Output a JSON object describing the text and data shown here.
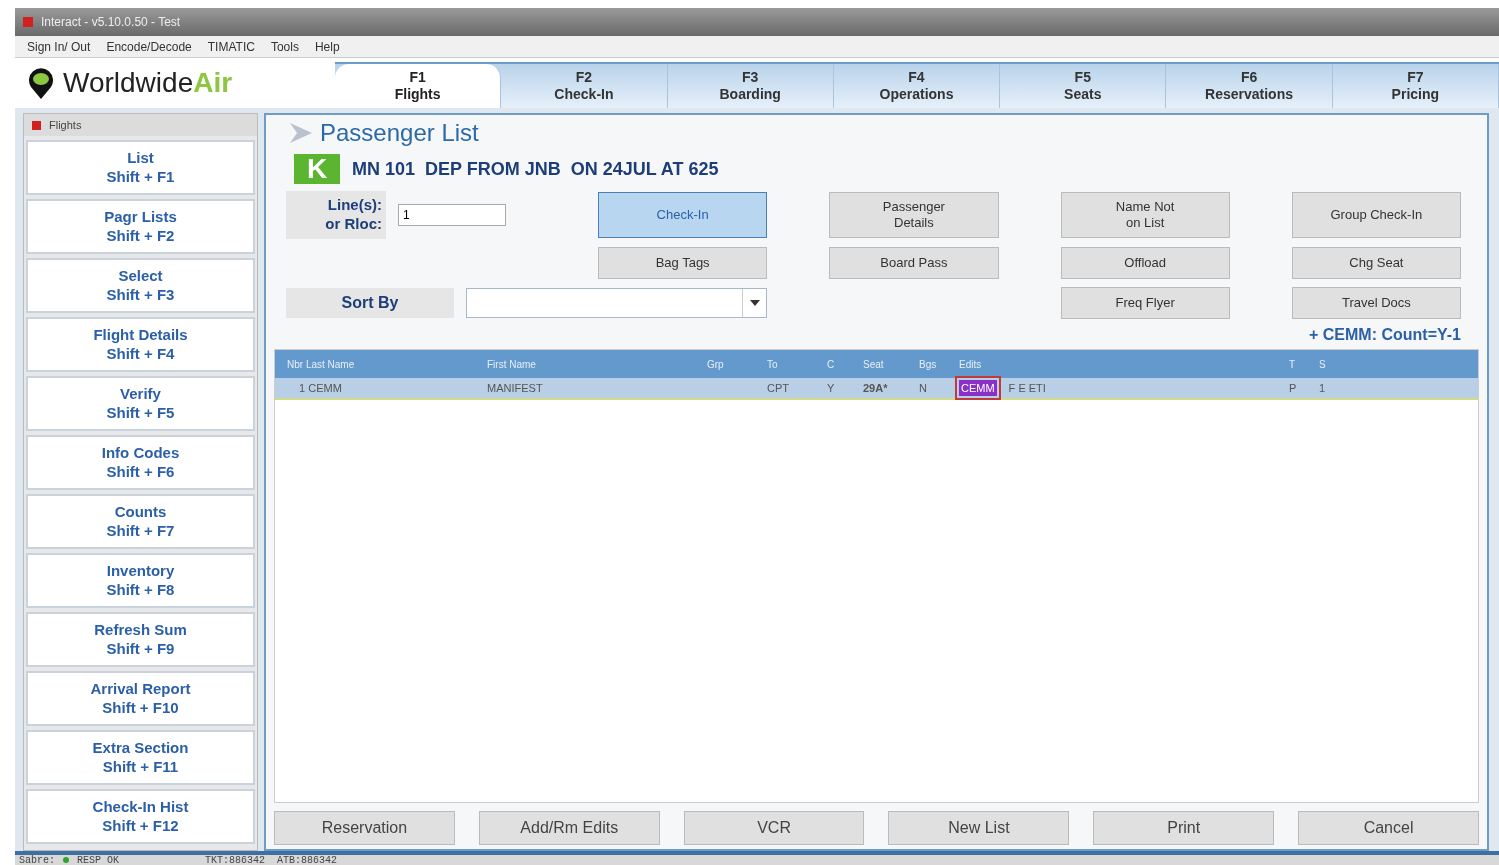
{
  "window": {
    "title": "Interact - v5.10.0.50 - Test"
  },
  "menu": [
    "Sign In/ Out",
    "Encode/Decode",
    "TIMATIC",
    "Tools",
    "Help"
  ],
  "logo": {
    "name": "Worldwide",
    "accent": "Air"
  },
  "tabs": [
    {
      "key": "F1",
      "label": "Flights",
      "selected": true
    },
    {
      "key": "F2",
      "label": "Check-In",
      "selected": false
    },
    {
      "key": "F3",
      "label": "Boarding",
      "selected": false
    },
    {
      "key": "F4",
      "label": "Operations",
      "selected": false
    },
    {
      "key": "F5",
      "label": "Seats",
      "selected": false
    },
    {
      "key": "F6",
      "label": "Reservations",
      "selected": false
    },
    {
      "key": "F7",
      "label": "Pricing",
      "selected": false
    }
  ],
  "sidebar": {
    "title": "Flights",
    "items": [
      {
        "label": "List",
        "shortcut": "Shift + F1"
      },
      {
        "label": "Pagr Lists",
        "shortcut": "Shift + F2"
      },
      {
        "label": "Select",
        "shortcut": "Shift + F3"
      },
      {
        "label": "Flight Details",
        "shortcut": "Shift + F4"
      },
      {
        "label": "Verify",
        "shortcut": "Shift + F5"
      },
      {
        "label": "Info Codes",
        "shortcut": "Shift + F6"
      },
      {
        "label": "Counts",
        "shortcut": "Shift + F7"
      },
      {
        "label": "Inventory",
        "shortcut": "Shift + F8"
      },
      {
        "label": "Refresh Sum",
        "shortcut": "Shift + F9"
      },
      {
        "label": "Arrival Report",
        "shortcut": "Shift + F10"
      },
      {
        "label": "Extra Section",
        "shortcut": "Shift + F11"
      },
      {
        "label": "Check-In Hist",
        "shortcut": "Shift + F12"
      }
    ]
  },
  "panel": {
    "title": "Passenger List",
    "badge": "K",
    "flight": "MN 101  DEP FROM JNB  ON 24JUL AT 625",
    "lines_label": "Line(s):\nor Rloc:",
    "lines_value": "1",
    "sort_label": "Sort By",
    "count_note": "+ CEMM: Count=Y-1",
    "action_rows": [
      [
        {
          "label": "Check-In",
          "selected": true
        },
        {
          "label": "Passenger\nDetails",
          "selected": false
        },
        {
          "label": "Name Not\non List",
          "selected": false
        },
        {
          "label": "Group Check-In",
          "selected": false
        }
      ],
      [
        {
          "label": "Bag Tags",
          "selected": false
        },
        {
          "label": "Board Pass",
          "selected": false
        },
        {
          "label": "Offload",
          "selected": false
        },
        {
          "label": "Chg Seat",
          "selected": false
        }
      ],
      [
        {
          "label": "Freq Flyer",
          "selected": false
        },
        {
          "label": "Travel Docs",
          "selected": false
        }
      ]
    ]
  },
  "table": {
    "columns": [
      "Nbr Last Name",
      "First Name",
      "Grp",
      "To",
      "C",
      "Seat",
      "Bgs",
      "Edits",
      "T",
      "S"
    ],
    "rows": [
      {
        "selected": true,
        "nbr": "1",
        "last": "CEMM",
        "first": "MANIFEST",
        "to": "CPT",
        "c": "Y",
        "seat": "29A*",
        "bgs": "N",
        "tag": "CEMM",
        "edits": "F E ETI",
        "t": "P",
        "s": "1"
      }
    ]
  },
  "bottom_buttons": [
    "Reservation",
    "Add/Rm Edits",
    "VCR",
    "New List",
    "Print",
    "Cancel"
  ],
  "status_bar": {
    "system": "Sabre:",
    "status": "RESP OK",
    "tickets": "TKT:886342  ATB:886342"
  }
}
